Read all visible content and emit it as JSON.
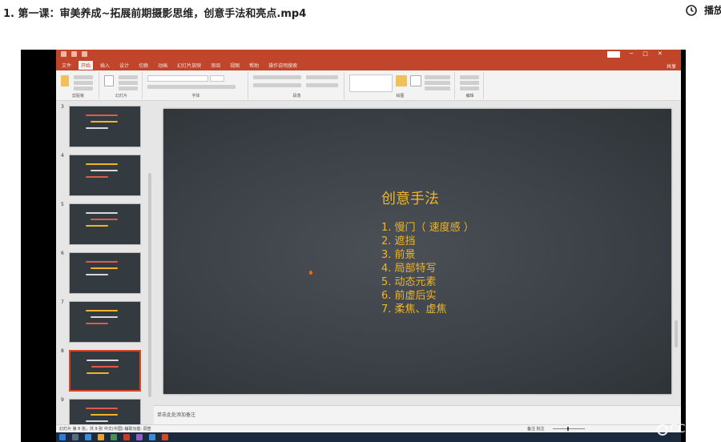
{
  "page": {
    "title": "1. 第一课：审美养成~拓展前期摄影思维，创意手法和亮点.mp4",
    "history_label": "播放"
  },
  "ppt": {
    "tabs": [
      "文件",
      "开始",
      "插入",
      "设计",
      "切换",
      "动画",
      "幻灯片放映",
      "审阅",
      "视图",
      "帮助",
      "操作说明搜索"
    ],
    "active_tab": 1,
    "share": "共享",
    "ribbon_groups": [
      "剪贴板",
      "幻灯片",
      "字体",
      "段落",
      "绘图",
      "编辑"
    ],
    "thumbnails": [
      {
        "num": "3"
      },
      {
        "num": "4"
      },
      {
        "num": "5"
      },
      {
        "num": "6"
      },
      {
        "num": "7"
      },
      {
        "num": "8"
      },
      {
        "num": "9"
      }
    ],
    "active_slide_index": 5,
    "slide": {
      "title": "创意手法",
      "items": [
        "1. 慢门（ 速度感 ）",
        "2. 遮挡",
        "3. 前景",
        "4. 局部特写",
        "5. 动态元素",
        "6. 前虚后实",
        "7. 柔焦、虚焦"
      ]
    },
    "notes_placeholder": "单击此处添加备注",
    "status_left": "幻灯片 第 8 张，共 9 张    中文(中国)    辅助功能: 调查",
    "status_right": "备注    批注"
  },
  "watermark": "CCtalk"
}
